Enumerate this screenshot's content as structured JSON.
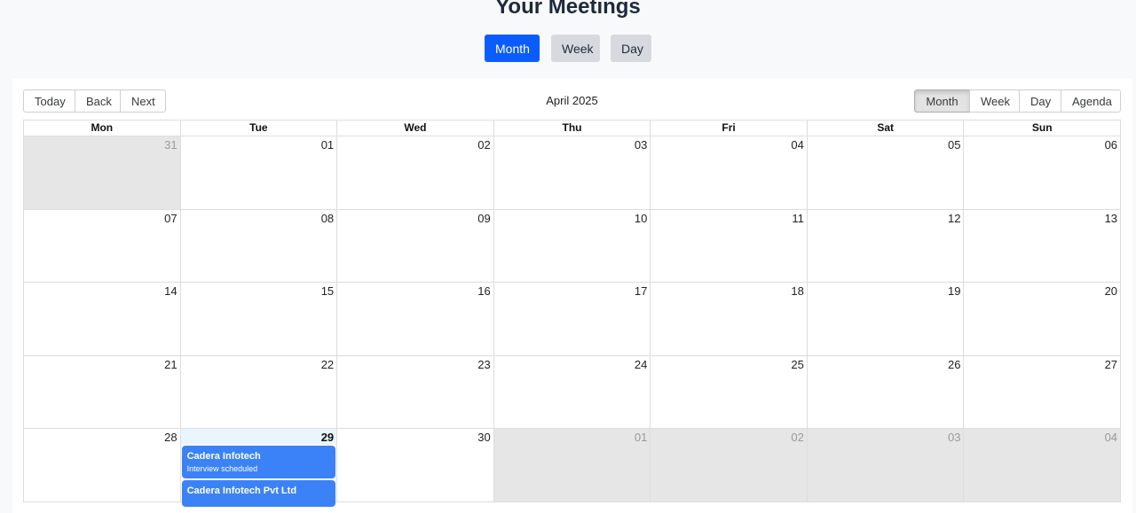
{
  "page": {
    "title": "Your Meetings"
  },
  "view_switch": {
    "month": "Month",
    "week": "Week",
    "day": "Day"
  },
  "toolbar": {
    "nav": {
      "today": "Today",
      "back": "Back",
      "next": "Next"
    },
    "label": "April 2025",
    "views": {
      "month": "Month",
      "week": "Week",
      "day": "Day",
      "agenda": "Agenda"
    }
  },
  "calendar": {
    "weekdays": [
      "Mon",
      "Tue",
      "Wed",
      "Thu",
      "Fri",
      "Sat",
      "Sun"
    ],
    "weeks": [
      [
        "31",
        "01",
        "02",
        "03",
        "04",
        "05",
        "06"
      ],
      [
        "07",
        "08",
        "09",
        "10",
        "11",
        "12",
        "13"
      ],
      [
        "14",
        "15",
        "16",
        "17",
        "18",
        "19",
        "20"
      ],
      [
        "21",
        "22",
        "23",
        "24",
        "25",
        "26",
        "27"
      ],
      [
        "28",
        "29",
        "30",
        "01",
        "02",
        "03",
        "04"
      ]
    ],
    "events": [
      {
        "title": "Cadera Infotech",
        "subtitle": "Interview scheduled"
      },
      {
        "title": "Cadera Infotech Pvt Ltd",
        "subtitle": ""
      }
    ]
  },
  "colors": {
    "accent": "#0b5cff",
    "event": "#3b82f6",
    "off_range": "#e6e6e6",
    "today": "#eaf6ff"
  }
}
